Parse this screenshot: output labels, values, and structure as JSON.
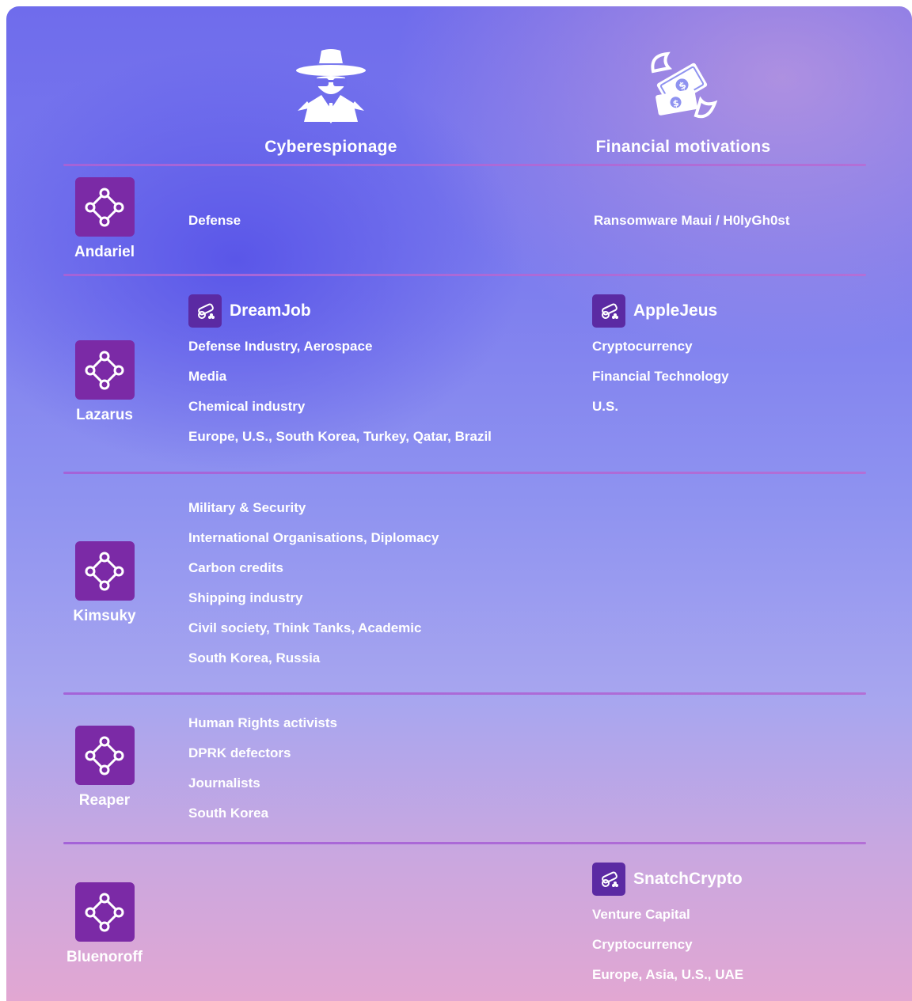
{
  "headers": {
    "cyberespionage": {
      "label": "Cyberespionage",
      "icon": "spy-icon"
    },
    "financial": {
      "label": "Financial motivations",
      "icon": "flying-money-icon"
    }
  },
  "groups": [
    {
      "name": "Andariel",
      "icon": "group-network-icon",
      "cyber": {
        "items": [
          "Defense"
        ]
      },
      "financial": {
        "items": [
          "Ransomware Maui / H0lyGh0st"
        ]
      }
    },
    {
      "name": "Lazarus",
      "icon": "group-network-icon",
      "cyber": {
        "campaign": "DreamJob",
        "items": [
          "Defense Industry, Aerospace",
          "Media",
          "Chemical industry",
          "Europe, U.S., South Korea, Turkey, Qatar, Brazil"
        ]
      },
      "financial": {
        "campaign": "AppleJeus",
        "items": [
          "Cryptocurrency",
          "Financial Technology",
          "U.S."
        ]
      }
    },
    {
      "name": "Kimsuky",
      "icon": "group-network-icon",
      "cyber": {
        "items": [
          "Military & Security",
          "International Organisations, Diplomacy",
          "Carbon credits",
          "Shipping industry",
          "Civil society, Think Tanks, Academic",
          "South Korea, Russia"
        ]
      }
    },
    {
      "name": "Reaper",
      "icon": "group-network-icon",
      "cyber": {
        "items": [
          "Human Rights activists",
          "DPRK defectors",
          "Journalists",
          "South Korea"
        ]
      }
    },
    {
      "name": "Bluenoroff",
      "icon": "group-network-icon",
      "financial": {
        "campaign": "SnatchCrypto",
        "items": [
          "Venture Capital",
          "Cryptocurrency",
          "Europe, Asia, U.S., UAE"
        ]
      }
    }
  ],
  "colors": {
    "group_icon_bg": "#7b2aa6",
    "campaign_icon_bg": "#5b2aa3",
    "divider": "#a463d8",
    "text": "#ffffff"
  }
}
